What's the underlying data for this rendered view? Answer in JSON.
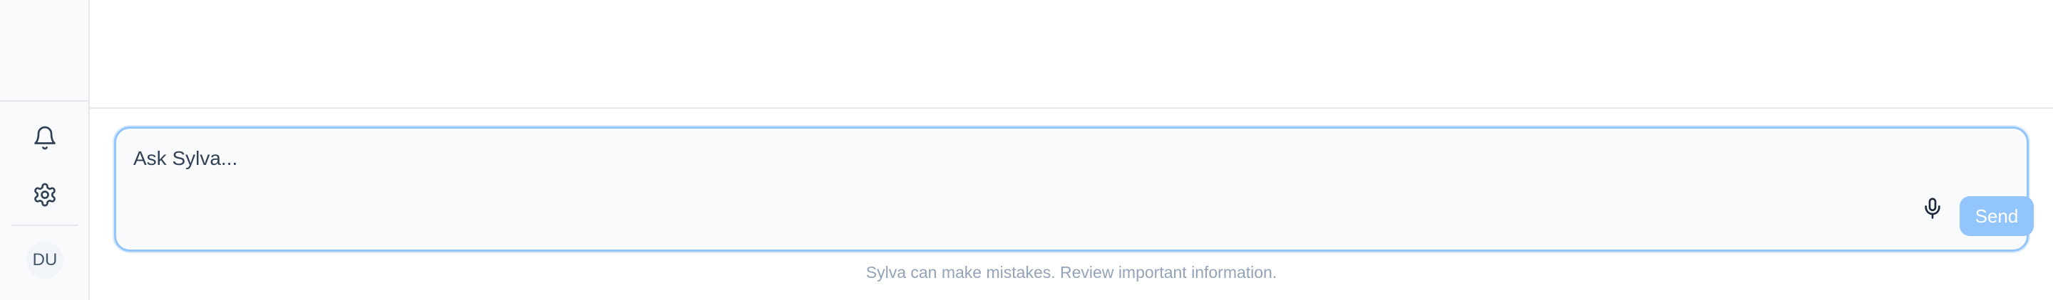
{
  "sidebar": {
    "icons": [
      "bell-icon",
      "gear-icon"
    ],
    "avatar_initials": "DU"
  },
  "composer": {
    "placeholder": "Ask Sylva...",
    "value": "",
    "mic_icon": "microphone-icon",
    "send_label": "Send"
  },
  "footer": {
    "disclaimer": "Sylva can make mistakes. Review important information."
  },
  "colors": {
    "accent": "#93c5fd",
    "sidebar_bg": "#f8fafc",
    "divider": "#e5e7eb",
    "muted_text": "#94a3b8"
  }
}
